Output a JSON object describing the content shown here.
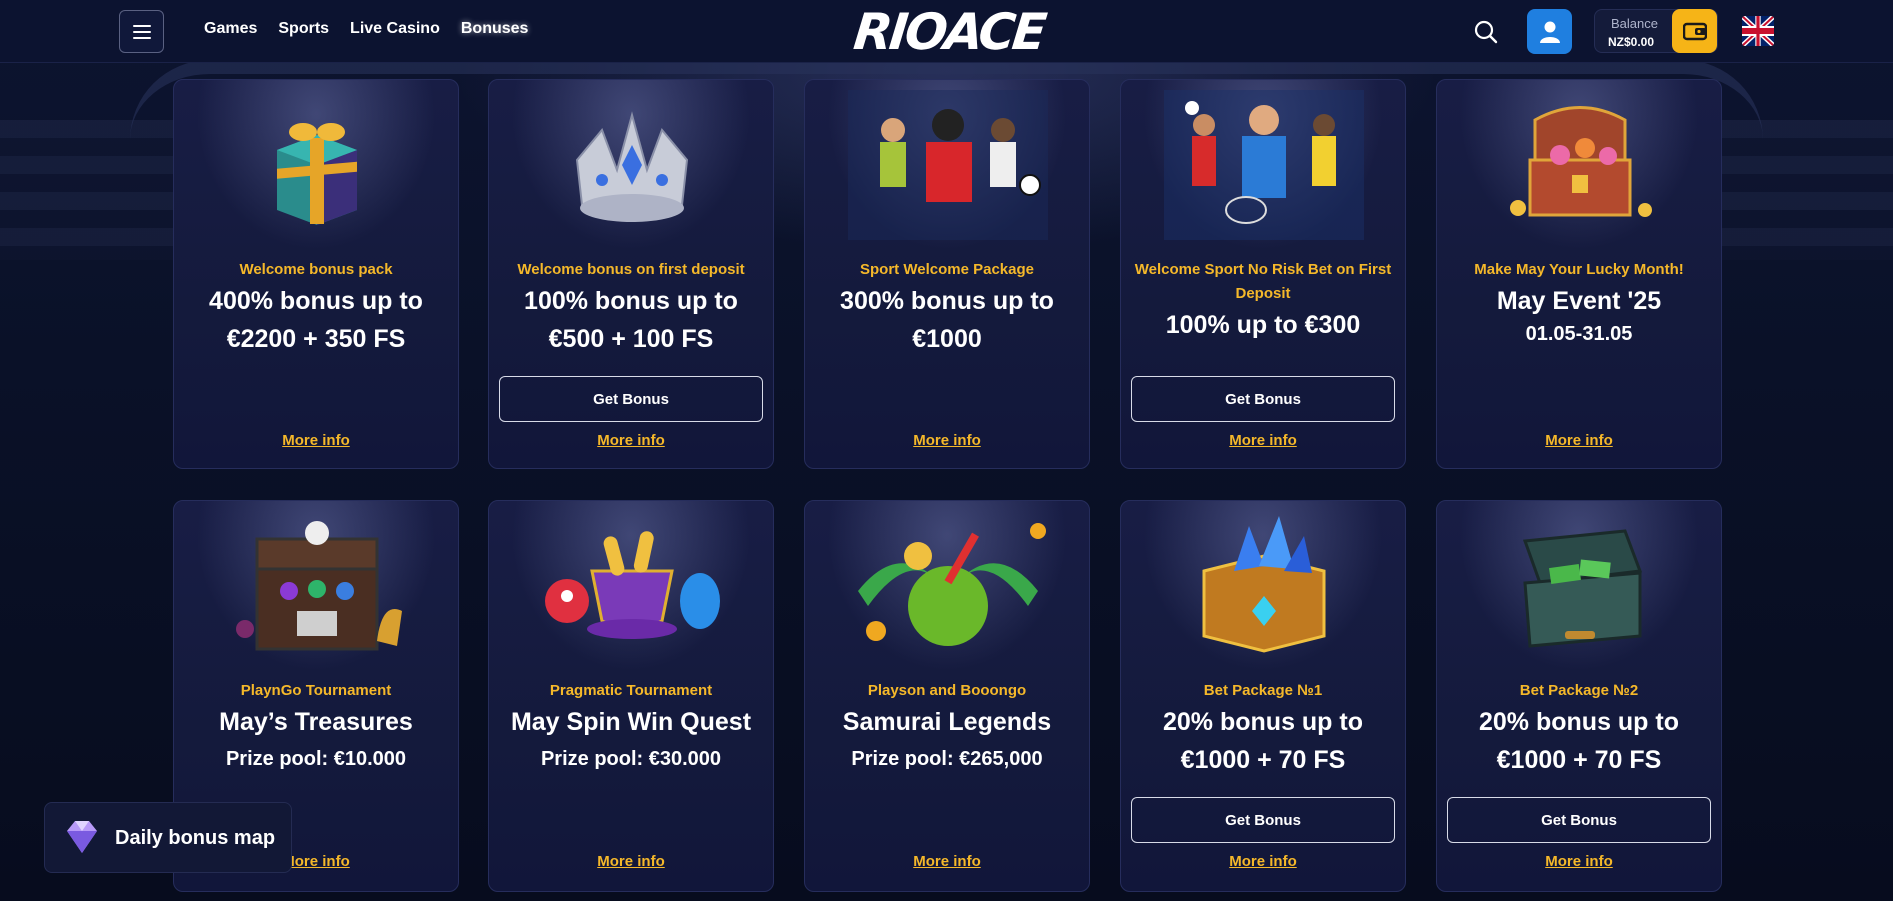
{
  "header": {
    "nav": [
      "Games",
      "Sports",
      "Live Casino",
      "Bonuses"
    ],
    "logo_text": "RIOACE",
    "balance_label": "Balance",
    "balance_value": "NZ$0.00"
  },
  "cards": [
    {
      "category": "Welcome bonus pack",
      "title": "400% bonus up to €2200 + 350 FS",
      "sub": "",
      "button": "",
      "more": "More info",
      "art": "gift-box-icon"
    },
    {
      "category": "Welcome bonus on first deposit",
      "title": "100% bonus up to €500 + 100 FS",
      "sub": "",
      "button": "Get Bonus",
      "more": "More info",
      "art": "crown-icon"
    },
    {
      "category": "Sport Welcome Package",
      "title": "300% bonus up to €1000",
      "sub": "",
      "button": "",
      "more": "More info",
      "art": "sport-players-icon"
    },
    {
      "category": "Welcome Sport No Risk Bet on First Deposit",
      "title": "100% up to €300",
      "sub": "",
      "button": "Get Bonus",
      "more": "More info",
      "art": "sport-athletes-icon"
    },
    {
      "category": "Make May Your Lucky Month!",
      "title": "May Event '25",
      "sub": "01.05-31.05",
      "button": "",
      "more": "More info",
      "art": "treasure-chest-icon"
    },
    {
      "category": "PlaynGo Tournament",
      "title": "May’s Treasures",
      "sub": "Prize pool: €10.000",
      "button": "",
      "more": "More info",
      "art": "skull-chest-icon"
    },
    {
      "category": "Pragmatic Tournament",
      "title": "May Spin Win Quest",
      "sub": "Prize pool: €30.000",
      "button": "",
      "more": "More info",
      "art": "candy-cup-icon"
    },
    {
      "category": "Playson and Booongo",
      "title": "Samurai Legends",
      "sub": "Prize pool: €265,000",
      "button": "",
      "more": "More info",
      "art": "coconut-cocktail-icon"
    },
    {
      "category": "Bet Package №1",
      "title": "20% bonus up to €1000 + 70 FS",
      "sub": "",
      "button": "Get Bonus",
      "more": "More info",
      "art": "crystal-chest-icon"
    },
    {
      "category": "Bet Package №2",
      "title": "20% bonus up to €1000 + 70 FS",
      "sub": "",
      "button": "Get Bonus",
      "more": "More info",
      "art": "money-case-icon"
    }
  ],
  "daily_map": {
    "label": "Daily bonus map"
  },
  "colors": {
    "accent": "#f5b82a",
    "user_button": "#1f7fe0",
    "wallet_button": "#f6b417",
    "background": "#0a1026"
  }
}
